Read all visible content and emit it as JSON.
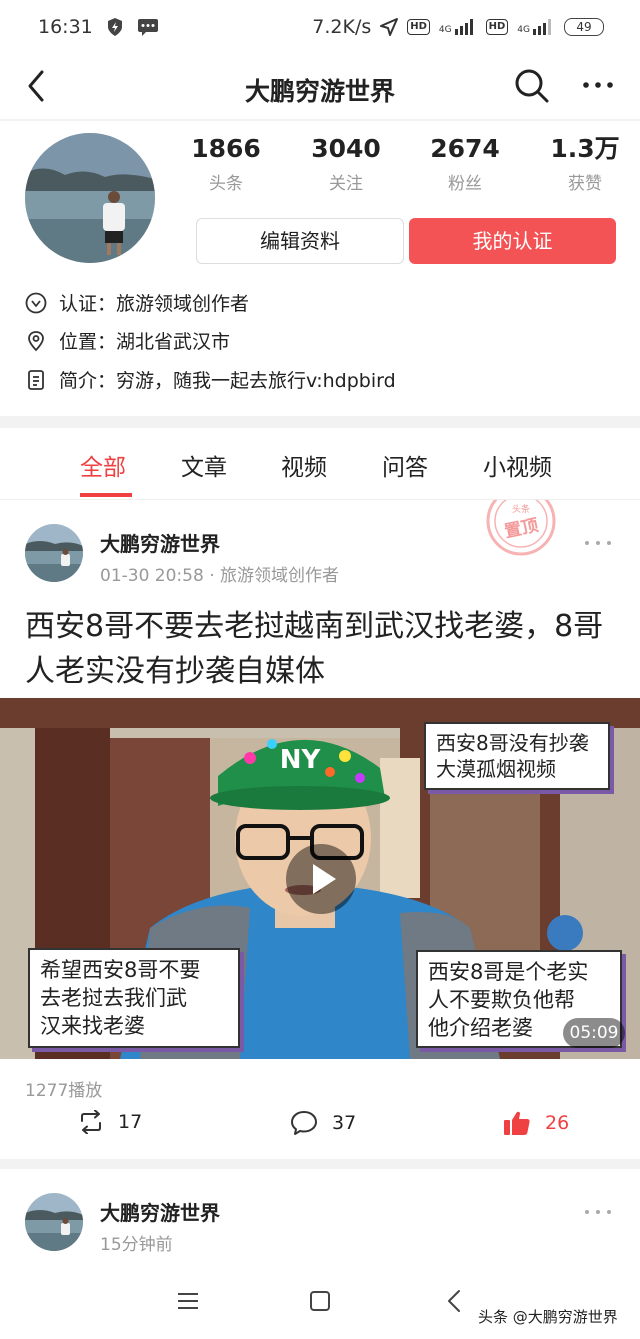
{
  "status_bar": {
    "time": "16:31",
    "speed": "7.2K/s",
    "hd1": "HD",
    "net1": "4G",
    "hd2": "HD",
    "net2": "4G",
    "battery": "49"
  },
  "header": {
    "title": "大鹏穷游世界"
  },
  "profile": {
    "stats": [
      {
        "value": "1866",
        "label": "头条"
      },
      {
        "value": "3040",
        "label": "关注"
      },
      {
        "value": "2674",
        "label": "粉丝"
      },
      {
        "value": "1.3万",
        "label": "获赞"
      }
    ],
    "edit_label": "编辑资料",
    "cert_label": "我的认证",
    "info": [
      {
        "icon": "verified-icon",
        "text": "认证：旅游领域创作者"
      },
      {
        "icon": "location-icon",
        "text": "位置：湖北省武汉市"
      },
      {
        "icon": "document-icon",
        "text": "简介：穷游，随我一起去旅行v:hdpbird"
      }
    ]
  },
  "tabs": [
    "全部",
    "文章",
    "视频",
    "问答",
    "小视频"
  ],
  "posts": [
    {
      "author": "大鹏穷游世界",
      "meta": "01-30 20:58 · 旅游领域创作者",
      "stamp_top": "头条",
      "stamp": "置顶",
      "title": "西安8哥不要去老挝越南到武汉找老婆，8哥人老实没有抄袭自媒体",
      "overlays": {
        "top_right": [
          "西安8哥没有抄袭",
          "大漠孤烟视频"
        ],
        "bottom_left": [
          "希望西安8哥不要",
          "去老挝去我们武",
          "汉来找老婆"
        ],
        "bottom_right": [
          "西安8哥是个老实",
          "人不要欺负他帮",
          "他介绍老婆"
        ],
        "cap_text": "NY"
      },
      "duration": "05:09",
      "plays": "1277播放",
      "shares": "17",
      "comments": "37",
      "likes": "26"
    },
    {
      "author": "大鹏穷游世界",
      "meta": "15分钟前"
    }
  ],
  "watermark": "头条 @大鹏穷游世界",
  "colors": {
    "accent": "#f04142",
    "cert_button": "#f35355",
    "muted": "#999999"
  }
}
